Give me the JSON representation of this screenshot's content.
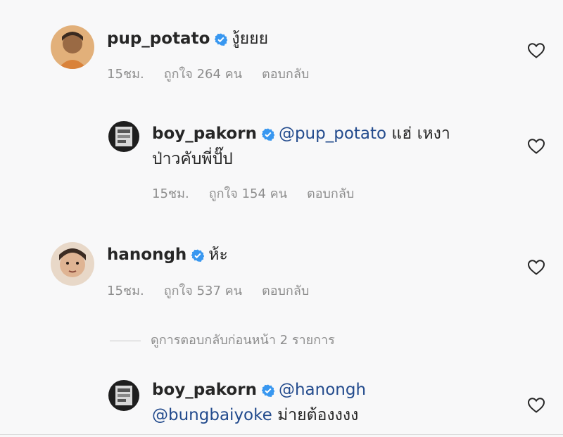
{
  "comments": [
    {
      "username": "pup_potato",
      "text": "งู้ยยย",
      "time": "15ชม.",
      "likes": "ถูกใจ 264 คน",
      "reply_label": "ตอบกลับ",
      "verified": true
    },
    {
      "username": "boy_pakorn",
      "mention": "@pup_potato",
      "text": "แฮ่ เหงา",
      "text_line2": "ป่าวคับพี่ปั๊ป",
      "time": "15ชม.",
      "likes": "ถูกใจ 154 คน",
      "reply_label": "ตอบกลับ",
      "verified": true
    },
    {
      "username": "hanongh",
      "text": "ห้ะ",
      "time": "15ชม.",
      "likes": "ถูกใจ 537 คน",
      "reply_label": "ตอบกลับ",
      "verified": true
    },
    {
      "username": "boy_pakorn",
      "mention": "@hanongh",
      "mention_line2": "@bungbaiyoke",
      "text_line2": "ม่ายต้องงงง",
      "verified": true
    }
  ],
  "view_previous_replies": "ดูการตอบกลับก่อนหน้า 2 รายการ",
  "colors": {
    "verified": "#3897f0",
    "mention": "#234b8d",
    "meta": "#8e8e8e"
  },
  "icons": {
    "verified": "verified-badge-icon",
    "like": "heart-outline-icon"
  }
}
